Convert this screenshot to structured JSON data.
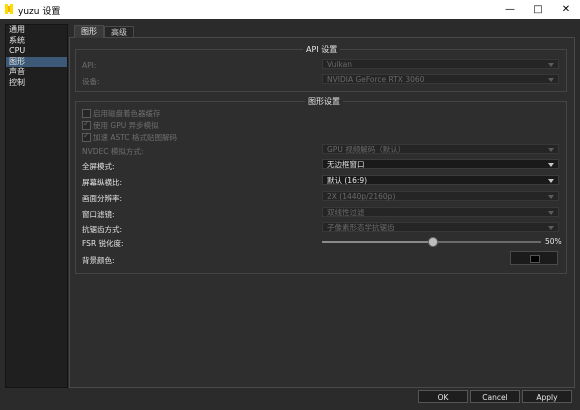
{
  "window": {
    "title": "yuzu 设置"
  },
  "sidebar": {
    "items": [
      {
        "label": "通用"
      },
      {
        "label": "系统"
      },
      {
        "label": "CPU"
      },
      {
        "label": "图形"
      },
      {
        "label": "声音"
      },
      {
        "label": "控制"
      }
    ],
    "selected": "图形"
  },
  "tabs": [
    {
      "label": "图形"
    },
    {
      "label": "高级"
    }
  ],
  "api_group": {
    "title": "API 设置",
    "api_label": "API:",
    "api_value": "Vulkan",
    "device_label": "设备:",
    "device_value": "NVIDIA GeForce RTX 3060"
  },
  "graphics_group": {
    "title": "图形设置",
    "checkboxes": [
      {
        "label": "启用磁盘着色器缓存",
        "checked": false
      },
      {
        "label": "使用 GPU 异步模拟",
        "checked": true
      },
      {
        "label": "加速 ASTC 格式贴图解码",
        "checked": true
      }
    ],
    "nvdec_label": "NVDEC 模拟方式:",
    "nvdec_value": "GPU 视频解码（默认）",
    "fullscreen_label": "全屏模式:",
    "fullscreen_value": "无边框窗口",
    "aspect_label": "屏幕纵横比:",
    "aspect_value": "默认 (16:9)",
    "resolution_label": "画面分辨率:",
    "resolution_value": "2X (1440p/2160p)",
    "filter_label": "窗口滤镜:",
    "filter_value": "双线性过滤",
    "aa_label": "抗锯齿方式:",
    "aa_value": "子像素形态学抗锯齿",
    "fsr_label": "FSR 锐化度:",
    "fsr_value": "50%",
    "fsr_level": 0.5,
    "bg_label": "背景颜色:",
    "bg_color": "#000000"
  },
  "buttons": {
    "ok": "OK",
    "cancel": "Cancel",
    "apply": "Apply"
  }
}
